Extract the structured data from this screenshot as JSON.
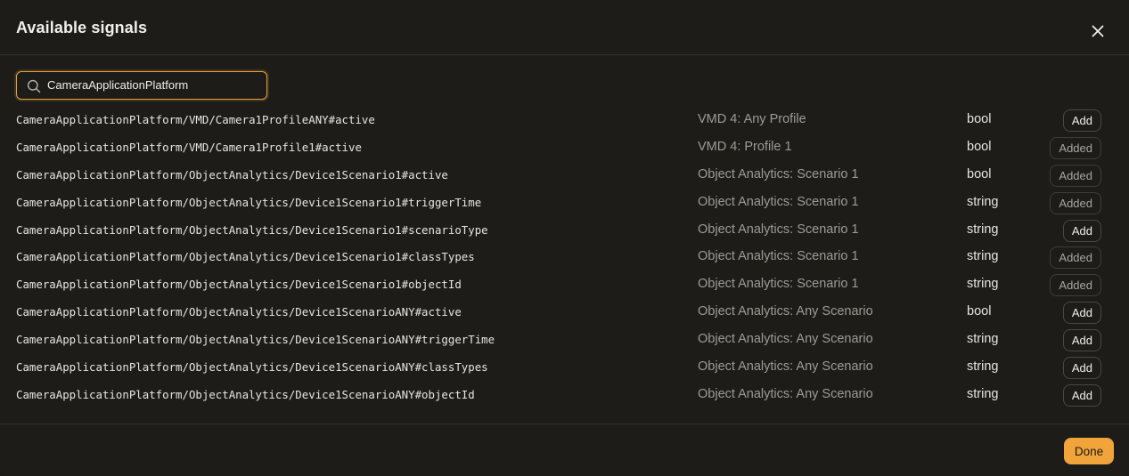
{
  "dialog": {
    "title": "Available signals",
    "close_icon": "close-icon"
  },
  "search": {
    "value": "CameraApplicationPlatform",
    "icon": "search-icon"
  },
  "signals": [
    {
      "path": "CameraApplicationPlatform/VMD/Camera1ProfileANY#active",
      "description": "VMD 4: Any Profile",
      "type": "bool",
      "action": "Add"
    },
    {
      "path": "CameraApplicationPlatform/VMD/Camera1Profile1#active",
      "description": "VMD 4: Profile 1",
      "type": "bool",
      "action": "Added"
    },
    {
      "path": "CameraApplicationPlatform/ObjectAnalytics/Device1Scenario1#active",
      "description": "Object Analytics: Scenario 1",
      "type": "bool",
      "action": "Added"
    },
    {
      "path": "CameraApplicationPlatform/ObjectAnalytics/Device1Scenario1#triggerTime",
      "description": "Object Analytics: Scenario 1",
      "type": "string",
      "action": "Added"
    },
    {
      "path": "CameraApplicationPlatform/ObjectAnalytics/Device1Scenario1#scenarioType",
      "description": "Object Analytics: Scenario 1",
      "type": "string",
      "action": "Add"
    },
    {
      "path": "CameraApplicationPlatform/ObjectAnalytics/Device1Scenario1#classTypes",
      "description": "Object Analytics: Scenario 1",
      "type": "string",
      "action": "Added"
    },
    {
      "path": "CameraApplicationPlatform/ObjectAnalytics/Device1Scenario1#objectId",
      "description": "Object Analytics: Scenario 1",
      "type": "string",
      "action": "Added"
    },
    {
      "path": "CameraApplicationPlatform/ObjectAnalytics/Device1ScenarioANY#active",
      "description": "Object Analytics: Any Scenario",
      "type": "bool",
      "action": "Add"
    },
    {
      "path": "CameraApplicationPlatform/ObjectAnalytics/Device1ScenarioANY#triggerTime",
      "description": "Object Analytics: Any Scenario",
      "type": "string",
      "action": "Add"
    },
    {
      "path": "CameraApplicationPlatform/ObjectAnalytics/Device1ScenarioANY#classTypes",
      "description": "Object Analytics: Any Scenario",
      "type": "string",
      "action": "Add"
    },
    {
      "path": "CameraApplicationPlatform/ObjectAnalytics/Device1ScenarioANY#objectId",
      "description": "Object Analytics: Any Scenario",
      "type": "string",
      "action": "Add"
    }
  ],
  "footer": {
    "done_label": "Done"
  },
  "colors": {
    "accent": "#f0a43a",
    "background": "#1d1c19",
    "muted_text": "#9e9b94"
  }
}
